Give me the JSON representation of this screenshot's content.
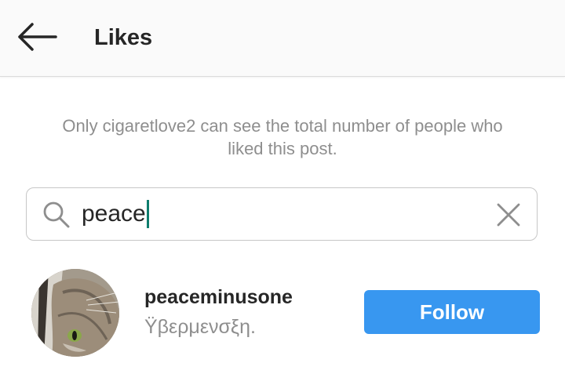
{
  "header": {
    "title": "Likes",
    "back_icon": "arrow-left-icon"
  },
  "notice": {
    "text": "Only cigaretlove2 can see the total number of people who liked this post."
  },
  "search": {
    "value": "peace",
    "search_icon": "search-icon",
    "clear_icon": "close-icon"
  },
  "results": [
    {
      "username": "peaceminusone",
      "full_name": "Ϋβερμενσξη.",
      "button_label": "Follow"
    }
  ],
  "colors": {
    "follow_button": "#3897f0",
    "caret": "#0e7d6d",
    "secondary_text": "#8e8e8e",
    "primary_text": "#262626"
  }
}
